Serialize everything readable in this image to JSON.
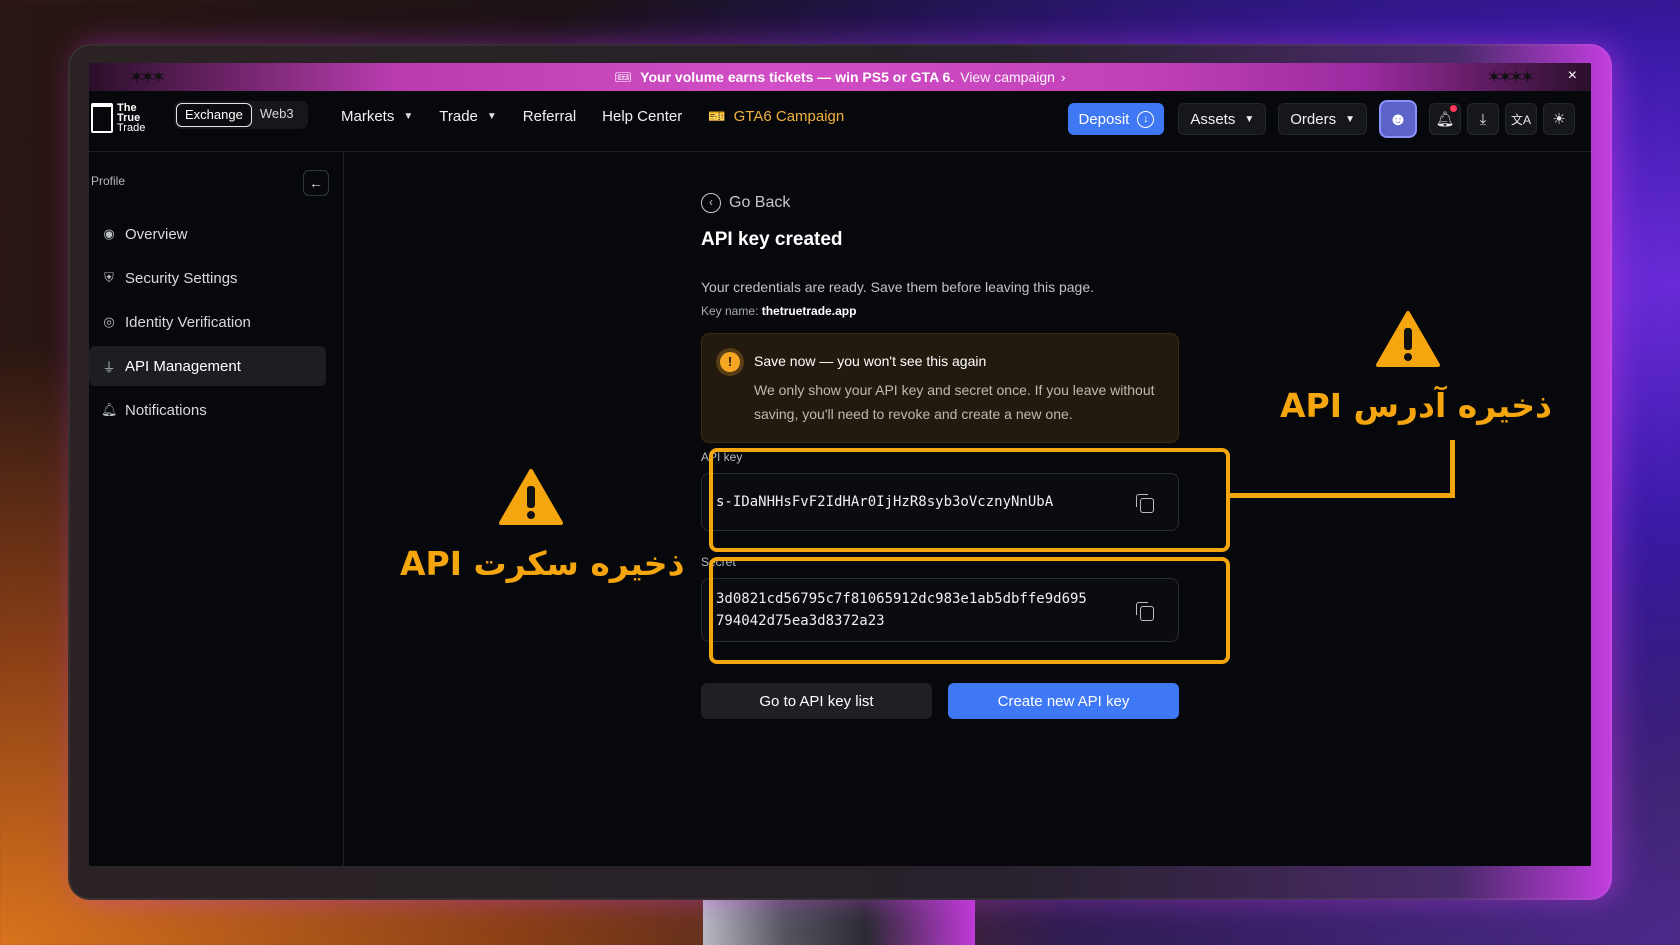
{
  "banner": {
    "text": "Your volume earns tickets — win PS5 or GTA 6.",
    "link": "View campaign",
    "chevron": "›",
    "close": "×",
    "ticket_icon": "ticket-icon"
  },
  "header": {
    "logo_text": [
      "The",
      "True",
      "Trade"
    ],
    "switch": [
      "Exchange",
      "Web3"
    ],
    "nav": [
      {
        "label": "Markets",
        "has_dropdown": true
      },
      {
        "label": "Trade",
        "has_dropdown": true
      },
      {
        "label": "Referral",
        "has_dropdown": false
      },
      {
        "label": "Help Center",
        "has_dropdown": false
      },
      {
        "label": "GTA6 Campaign",
        "has_dropdown": false
      }
    ],
    "deposit": "Deposit",
    "assets": "Assets",
    "orders": "Orders"
  },
  "sidebar": {
    "title": "Profile",
    "items": [
      {
        "label": "Overview",
        "icon": "user-circle-icon",
        "active": false
      },
      {
        "label": "Security Settings",
        "icon": "shield-icon",
        "active": false
      },
      {
        "label": "Identity Verification",
        "icon": "fingerprint-icon",
        "active": false
      },
      {
        "label": "API Management",
        "icon": "plug-icon",
        "active": true
      },
      {
        "label": "Notifications",
        "icon": "bell-icon",
        "active": false
      }
    ]
  },
  "main": {
    "go_back": "Go Back",
    "title": "API key created",
    "description": "Your credentials are ready. Save them before leaving this page.",
    "key_name_label": "Key name:",
    "key_name_value": "thetruetrade.app",
    "warning_title": "Save now — you won't see this again",
    "warning_body": "We only show your API key and secret once. If you leave without saving, you'll need to revoke and create a new one.",
    "api_key_label": "API key",
    "api_key_value": "s-IDaNHHsFvF2IdHAr0IjHzR8syb3oVcznyNnUbA",
    "secret_label": "Secret",
    "secret_line1": "3d0821cd56795c7f81065912dc983e1ab5dbffe9d695",
    "secret_line2": "794042d75ea3d8372a23",
    "btn_list": "Go to API key list",
    "btn_create": "Create new API key"
  },
  "annotations": {
    "secret_text": "ذخیره سکرت API",
    "address_text": "ذخیره آدرس API",
    "accent_color": "#f5a50e"
  },
  "colors": {
    "primary": "#3f78f4",
    "promo": "#d24ec6",
    "campaign": "#f2b33d",
    "warning": "#f5a623"
  }
}
